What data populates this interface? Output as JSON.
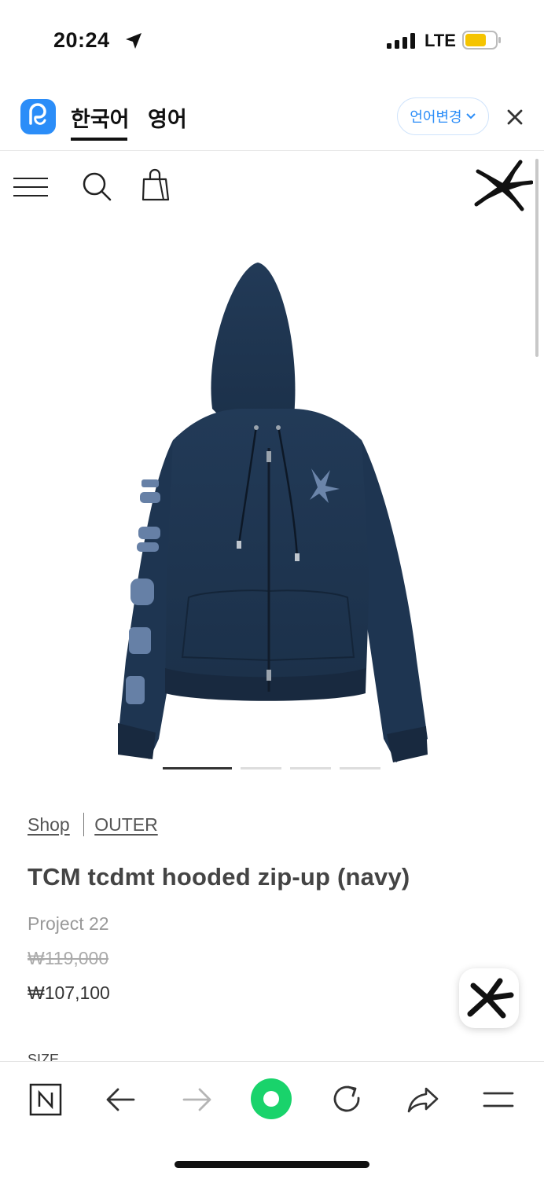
{
  "status_bar": {
    "time": "20:24",
    "network": "LTE",
    "battery_color": "#f5c400"
  },
  "translate_bar": {
    "source_lang": "한국어",
    "target_lang": "영어",
    "change_button": "언어변경",
    "accent": "#2b8df8"
  },
  "breadcrumb": {
    "shop": "Shop",
    "category": "OUTER"
  },
  "product": {
    "title": "TCM tcdmt hooded zip-up (navy)",
    "brand": "Project 22",
    "original_price": "₩119,000",
    "sale_price": "₩107,100",
    "size_label": "SIZE",
    "color": "#1f3550",
    "image_count": 4,
    "active_image": 1
  },
  "icons": {
    "header": [
      "menu-icon",
      "search-icon",
      "shopping-bag-icon",
      "starfish-logo-icon"
    ],
    "toolbar": [
      "naver-n-icon",
      "back-arrow-icon",
      "forward-arrow-icon",
      "green-dot-icon",
      "refresh-icon",
      "share-icon",
      "menu-icon"
    ]
  }
}
